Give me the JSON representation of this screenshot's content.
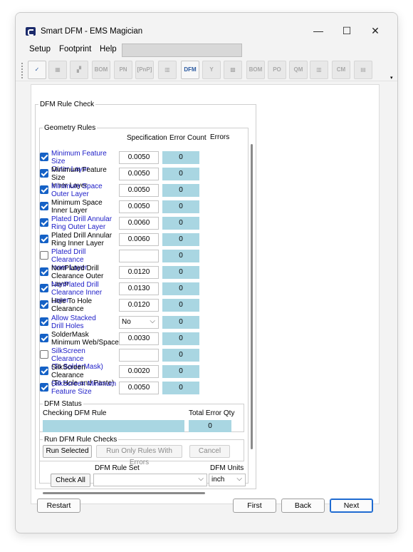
{
  "window": {
    "title": "Smart DFM - EMS Magician",
    "minimize": "—",
    "maximize": "☐",
    "close": "✕"
  },
  "menu": {
    "setup": "Setup",
    "footprint": "Footprint",
    "help": "Help"
  },
  "toolbar": {
    "buttons": [
      {
        "icon": "check-document-icon",
        "label": "✓"
      },
      {
        "icon": "grid-icon",
        "label": "▦"
      },
      {
        "icon": "pnp-boxes-icon",
        "label": "▞"
      },
      {
        "icon": "bom-pnp-icon",
        "label": "BOM PnP"
      },
      {
        "icon": "pn-123-icon",
        "label": "PN 123"
      },
      {
        "icon": "pnp-icon",
        "label": "[PnP]"
      },
      {
        "icon": "component-icon",
        "label": "▥"
      },
      {
        "icon": "dfm-icon",
        "label": "DFM"
      },
      {
        "icon": "y-box-icon",
        "label": "Y"
      },
      {
        "icon": "matrix-icon",
        "label": "▩"
      },
      {
        "icon": "bom-icon",
        "label": "BOM"
      },
      {
        "icon": "po-icon",
        "label": "PO"
      },
      {
        "icon": "qm-icon",
        "label": "QM"
      },
      {
        "icon": "chip-icon",
        "label": "▥"
      },
      {
        "icon": "cm-icon",
        "label": "CM"
      },
      {
        "icon": "panel-icon",
        "label": "▤"
      }
    ],
    "overflow": "▾"
  },
  "dfm_rule_check": {
    "legend": "DFM Rule Check",
    "geometry_legend": "Geometry Rules",
    "col_specification": "Specification",
    "col_error_count": "Error Count",
    "col_errors": "Errors",
    "rules": [
      {
        "label": "Minimum Feature Size Outer Layer",
        "checked": true,
        "spec": "0.0050",
        "errors": "0",
        "color": "blue"
      },
      {
        "label": "Minimum Feature Size Inner Layer",
        "checked": true,
        "spec": "0.0050",
        "errors": "0",
        "color": "black"
      },
      {
        "label": "Minimum Space Outer Layer",
        "checked": true,
        "spec": "0.0050",
        "errors": "0",
        "color": "blue"
      },
      {
        "label": "Minimum Space Inner Layer",
        "checked": true,
        "spec": "0.0050",
        "errors": "0",
        "color": "black"
      },
      {
        "label": "Plated Drill Annular Ring Outer Layer",
        "checked": true,
        "spec": "0.0060",
        "errors": "0",
        "color": "blue"
      },
      {
        "label": "Plated Drill Annular Ring Inner Layer",
        "checked": true,
        "spec": "0.0060",
        "errors": "0",
        "color": "black"
      },
      {
        "label": "Plated Drill Clearance Inner Layer",
        "checked": false,
        "spec": "",
        "errors": "0",
        "color": "blue"
      },
      {
        "label": "NonPlated Drill Clearance Outer Layer",
        "checked": true,
        "spec": "0.0120",
        "errors": "0",
        "color": "black"
      },
      {
        "label": "NonPlated Drill Clearance Inner Layer",
        "checked": true,
        "spec": "0.0130",
        "errors": "0",
        "color": "blue"
      },
      {
        "label": "Hole To Hole Clearance",
        "checked": true,
        "spec": "0.0120",
        "errors": "0",
        "color": "black"
      },
      {
        "label": "Allow Stacked Drill Holes",
        "checked": true,
        "spec": "No",
        "errors": "0",
        "color": "blue",
        "select": true
      },
      {
        "label": "SolderMask Minimum Web/Space",
        "checked": true,
        "spec": "0.0030",
        "errors": "0",
        "color": "black"
      },
      {
        "label": "SilkScreen Clearance (To SolderMask)",
        "checked": false,
        "spec": "",
        "errors": "0",
        "color": "blue"
      },
      {
        "label": "SilkScreen Clearance (To Hole and Paste)",
        "checked": true,
        "spec": "0.0020",
        "errors": "0",
        "color": "black"
      },
      {
        "label": "SilkScreen Minimum Feature Size",
        "checked": true,
        "spec": "0.0050",
        "errors": "0",
        "color": "blue"
      }
    ],
    "rule_lines": [
      [
        "Minimum Feature Size",
        "Outer Layer"
      ],
      [
        "Minimum Feature Size",
        "Inner Layer"
      ],
      [
        "Minimum Space",
        "Outer Layer"
      ],
      [
        "Minimum Space",
        "Inner Layer"
      ],
      [
        "Plated Drill Annular",
        "Ring Outer Layer"
      ],
      [
        "Plated Drill Annular",
        "Ring Inner Layer"
      ],
      [
        "Plated Drill Clearance",
        "Inner Layer"
      ],
      [
        "NonPlated Drill",
        "Clearance Outer Layer"
      ],
      [
        "NonPlated Drill",
        "Clearance Inner Layer"
      ],
      [
        "Hole To Hole",
        "Clearance"
      ],
      [
        "Allow Stacked",
        "Drill Holes"
      ],
      [
        "SolderMask",
        "Minimum Web/Space"
      ],
      [
        "SilkScreen Clearance",
        "(To SolderMask)"
      ],
      [
        "SilkScreen Clearance",
        "(To Hole and Paste)"
      ],
      [
        "SilkScreen Minimum",
        "Feature Size"
      ]
    ],
    "status": {
      "legend": "DFM Status",
      "checking_label": "Checking DFM Rule",
      "total_label": "Total Error Qty",
      "total_value": "0"
    },
    "run": {
      "legend": "Run DFM Rule Checks",
      "run_selected": "Run Selected",
      "run_only_errors": "Run Only Rules With Errors",
      "cancel": "Cancel"
    },
    "check_all": "Check All",
    "rule_set_label": "DFM Rule Set",
    "rule_set_value": "",
    "units_label": "DFM Units",
    "units_value": "inch"
  },
  "footer": {
    "restart": "Restart",
    "first": "First",
    "back": "Back",
    "next": "Next"
  },
  "colors": {
    "accent_blue": "#2020c8",
    "checkbox_blue": "#1561c6",
    "error_cell": "#a9d6e2",
    "primary_button_border": "#1f6bd1"
  }
}
